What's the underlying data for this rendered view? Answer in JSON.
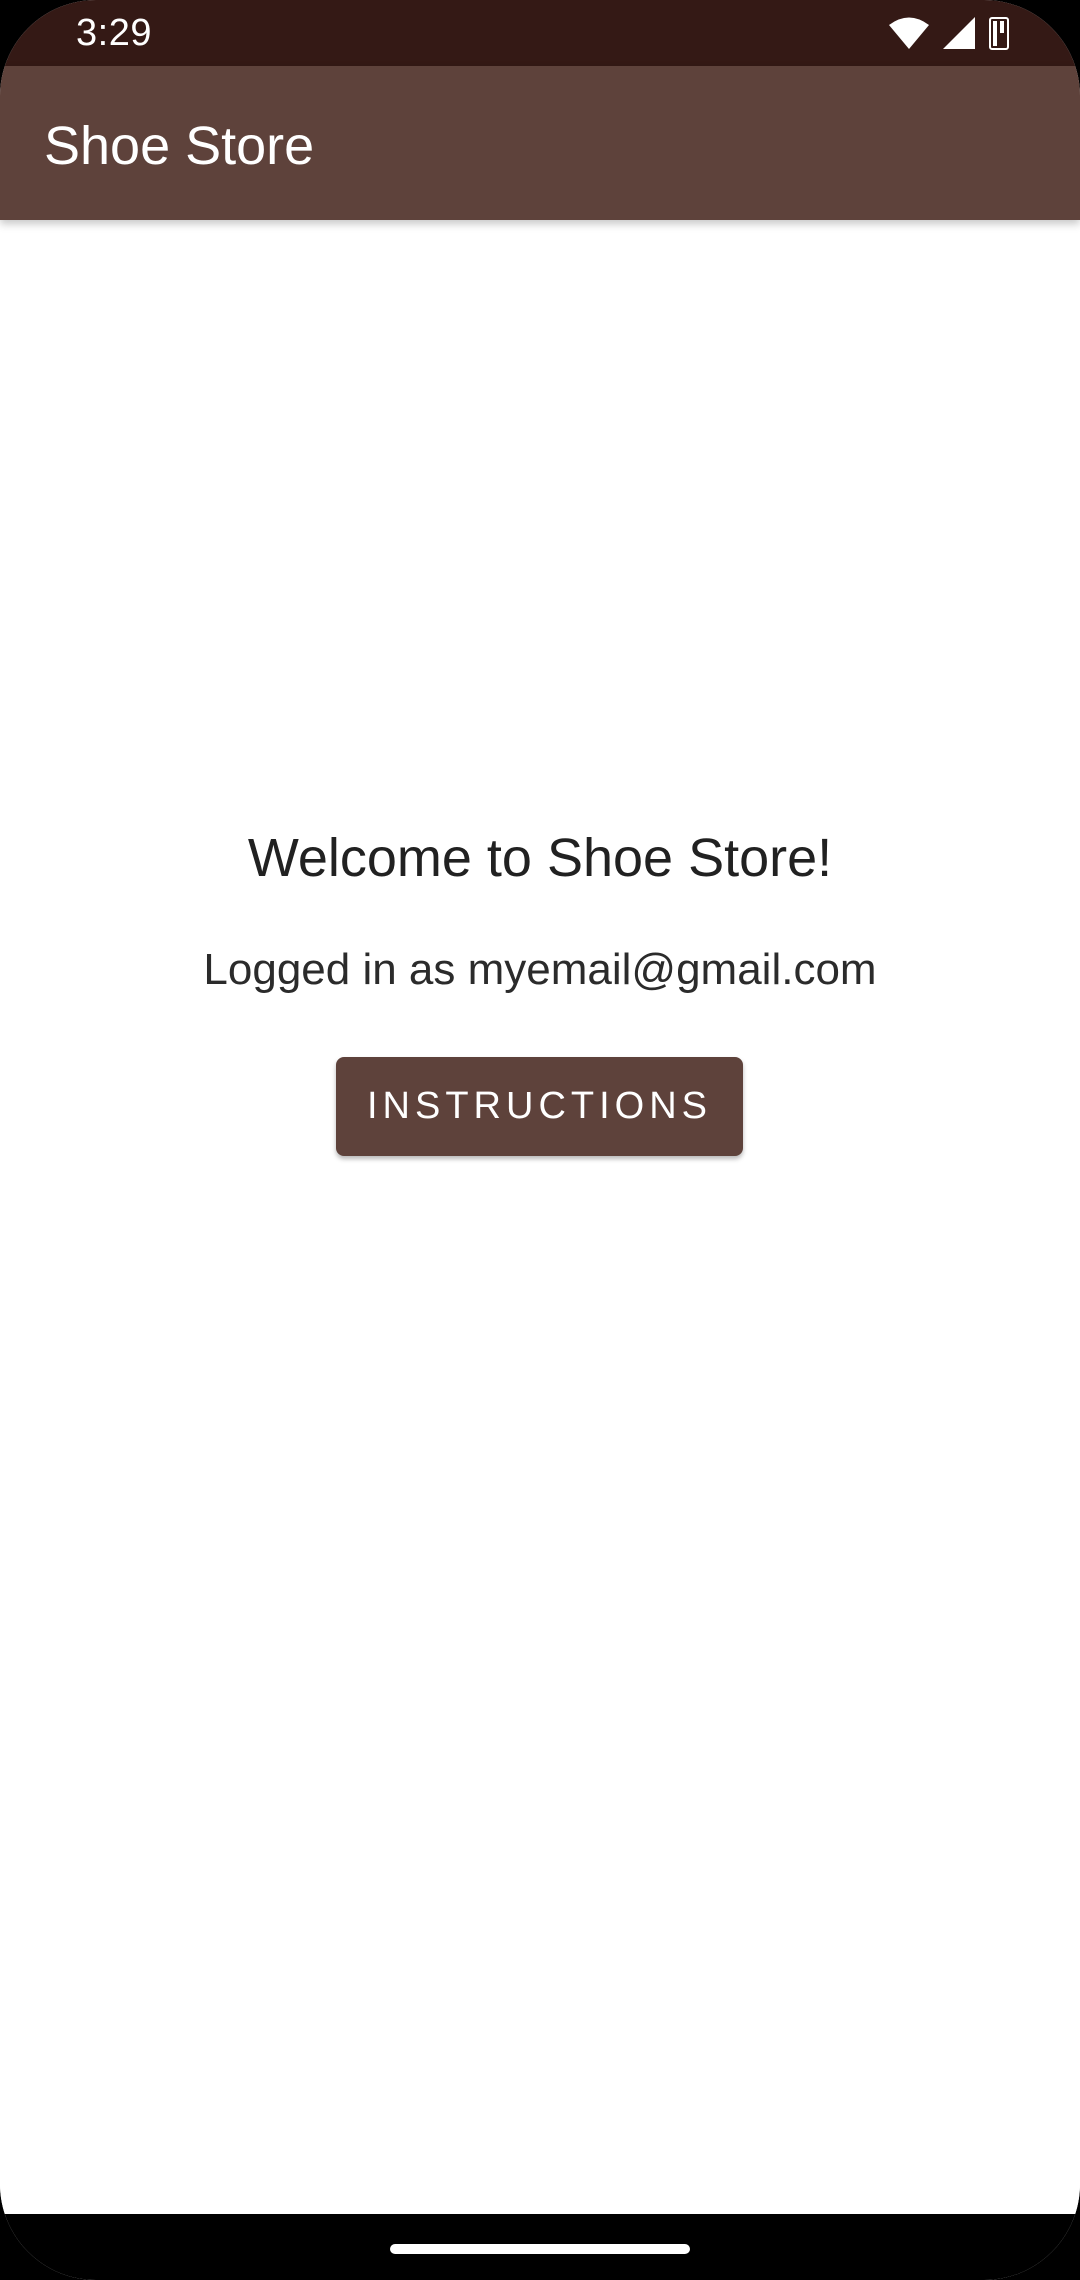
{
  "status_bar": {
    "time": "3:29",
    "icons": [
      "wifi-icon",
      "cellular-signal-icon",
      "battery-icon"
    ]
  },
  "app_bar": {
    "title": "Shoe Store"
  },
  "welcome": {
    "title": "Welcome to Shoe Store!",
    "logged_in_text": "Logged in as myemail@gmail.com",
    "instructions_label": "INSTRUCTIONS"
  },
  "colors": {
    "status_bar": "#341915",
    "primary": "#5e423b",
    "on_primary": "#ffffff",
    "background": "#ffffff"
  }
}
